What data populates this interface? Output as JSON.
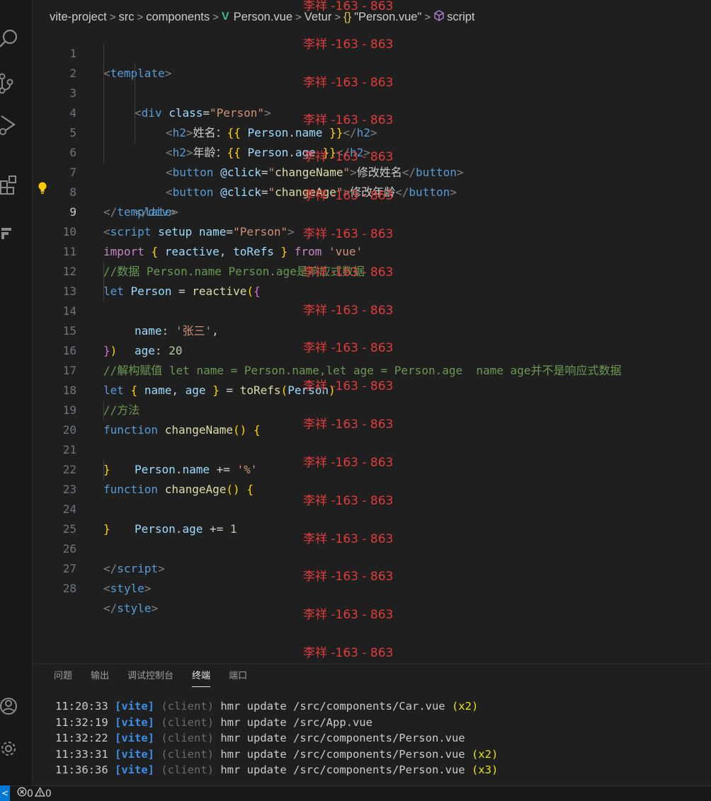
{
  "breadcrumb": {
    "items": [
      "vite-project",
      "src",
      "components",
      "Person.vue",
      "Vetur",
      "\"Person.vue\"",
      "script"
    ],
    "vue_mark": "V",
    "brace": "{}"
  },
  "code": {
    "line_numbers": [
      "1",
      "2",
      "3",
      "4",
      "5",
      "6",
      "7",
      "8",
      "9",
      "10",
      "11",
      "12",
      "13",
      "14",
      "15",
      "16",
      "17",
      "18",
      "19",
      "20",
      "21",
      "22",
      "23",
      "24",
      "25",
      "26",
      "27",
      "28"
    ],
    "l1": [
      "<",
      "template",
      ">"
    ],
    "l2": [
      "<",
      "div",
      "class",
      "=",
      "\"Person\"",
      ">"
    ],
    "l3": [
      "<",
      "h2",
      ">",
      "姓名：",
      "{{",
      "Person",
      ".",
      "name",
      "}}",
      "</",
      "h2",
      ">"
    ],
    "l4": [
      "<",
      "h2",
      ">",
      "年龄：",
      "{{",
      "Person",
      ".",
      "age",
      "}}",
      "</",
      "h2",
      ">"
    ],
    "l5": [
      "<",
      "button",
      "@click",
      "=",
      "\"",
      "changeName",
      "\"",
      ">",
      "修改姓名",
      "</",
      "button",
      ">"
    ],
    "l6": [
      "<",
      "button",
      "@click",
      "=",
      "\"",
      "changeAge",
      "\"",
      ">",
      "修改年龄",
      "</",
      "button",
      ">"
    ],
    "l7": [
      "</",
      "div",
      ">"
    ],
    "l8": [
      "</",
      "template",
      ">"
    ],
    "l9": [
      "<",
      "script",
      "setup",
      "name",
      "=",
      "\"Person\"",
      ">"
    ],
    "l10": [
      "import",
      "{",
      "reactive",
      ",",
      "toRefs",
      "}",
      "from",
      "'vue'"
    ],
    "l11": "//数据 Person.name Person.age是响应式数据",
    "l12": [
      "let",
      "Person",
      "=",
      "reactive",
      "(",
      "{"
    ],
    "l13": [
      "name",
      ":",
      "'张三'",
      ","
    ],
    "l14": [
      "age",
      ":",
      "20"
    ],
    "l15": [
      "}",
      ")"
    ],
    "l16": "//解构赋值 let name = Person.name,let age = Person.age  name age并不是响应式数据",
    "l17": [
      "let",
      "{",
      "name",
      ",",
      "age",
      "}",
      "=",
      "toRefs",
      "(",
      "Person",
      ")"
    ],
    "l18": "//方法",
    "l19": [
      "function",
      "changeName",
      "()",
      "{"
    ],
    "l20": [
      "Person",
      ".",
      "name",
      "+=",
      "'%'"
    ],
    "l21": [
      "}"
    ],
    "l22": [
      "function",
      "changeAge",
      "()",
      "{"
    ],
    "l23": [
      "Person",
      ".",
      "age",
      "+=",
      "1"
    ],
    "l24": [
      "}"
    ],
    "l26": [
      "</",
      "script",
      ">"
    ],
    "l27": [
      "<",
      "style",
      ">"
    ],
    "l28": [
      "</",
      "style",
      ">"
    ]
  },
  "watermark_text": "李祥 -163 - 863",
  "panel": {
    "tabs": [
      "问题",
      "输出",
      "调试控制台",
      "终端",
      "端口"
    ]
  },
  "terminal": {
    "lines": [
      {
        "time": "11:20:33",
        "tag": "[vite]",
        "client": "(client)",
        "msg": "hmr update /src/components/Car.vue",
        "count": "(x2)"
      },
      {
        "time": "11:32:19",
        "tag": "[vite]",
        "client": "(client)",
        "msg": "hmr update /src/App.vue",
        "count": ""
      },
      {
        "time": "11:32:22",
        "tag": "[vite]",
        "client": "(client)",
        "msg": "hmr update /src/components/Person.vue",
        "count": ""
      },
      {
        "time": "11:33:31",
        "tag": "[vite]",
        "client": "(client)",
        "msg": "hmr update /src/components/Person.vue",
        "count": "(x2)"
      },
      {
        "time": "11:36:36",
        "tag": "[vite]",
        "client": "(client)",
        "msg": "hmr update /src/components/Person.vue",
        "count": "(x3)"
      }
    ]
  },
  "statusbar": {
    "remote": "<",
    "errors": "0",
    "warnings": "0"
  }
}
